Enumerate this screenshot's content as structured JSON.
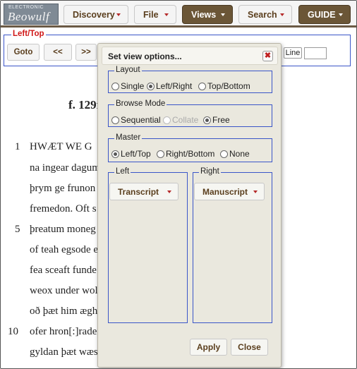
{
  "logo": {
    "small_text": "ELECTRONIC",
    "big_text": "Beowulf"
  },
  "nav": [
    {
      "label": "Discovery"
    },
    {
      "label": "File"
    },
    {
      "label": "Views"
    },
    {
      "label": "Search"
    },
    {
      "label": "GUIDE"
    }
  ],
  "panel": {
    "title": "Left/Top",
    "buttons": {
      "goto": "Goto",
      "prev": "<<",
      "next": ">>"
    },
    "line_label": "Line",
    "line_value": ""
  },
  "text": {
    "folio": "f. 129r",
    "lines": [
      {
        "num": "1",
        "text": "HWÆT WE G"
      },
      {
        "num": "",
        "text": "na ingear dagum"
      },
      {
        "num": "",
        "text": "þrym ge frunon"
      },
      {
        "num": "",
        "text": "fremedon. Oft s"
      },
      {
        "num": "5",
        "text": "þreatum moneg"
      },
      {
        "num": "",
        "text": "of teah egsode e"
      },
      {
        "num": "",
        "text": "fea sceaft funde"
      },
      {
        "num": "",
        "text": "weox under wol"
      },
      {
        "num": "",
        "text": "oð þæt him ægh"
      },
      {
        "num": "10",
        "text": "ofer hron[:]rade"
      },
      {
        "num": "",
        "text": "gyldan þæt wæs"
      }
    ]
  },
  "dialog": {
    "title": "Set view options...",
    "close": "✖",
    "layout": {
      "legend": "Layout",
      "options": [
        "Single",
        "Left/Right",
        "Top/Bottom"
      ],
      "selected": "Left/Right"
    },
    "browse": {
      "legend": "Browse Mode",
      "options": [
        "Sequential",
        "Collate",
        "Free"
      ],
      "selected": "Free",
      "disabled": "Collate"
    },
    "master": {
      "legend": "Master",
      "options": [
        "Left/Top",
        "Right/Bottom",
        "None"
      ],
      "selected": "Left/Top"
    },
    "left": {
      "legend": "Left",
      "value": "Transcript"
    },
    "right": {
      "legend": "Right",
      "value": "Manuscript"
    },
    "apply": "Apply",
    "close_button": "Close"
  },
  "colors": {
    "accent_brown": "#5a3e1d",
    "dark_button": "#6b5637",
    "fieldset_border": "#3a55c8",
    "panel_title": "#d01818",
    "dialog_bg": "#eae8de"
  }
}
